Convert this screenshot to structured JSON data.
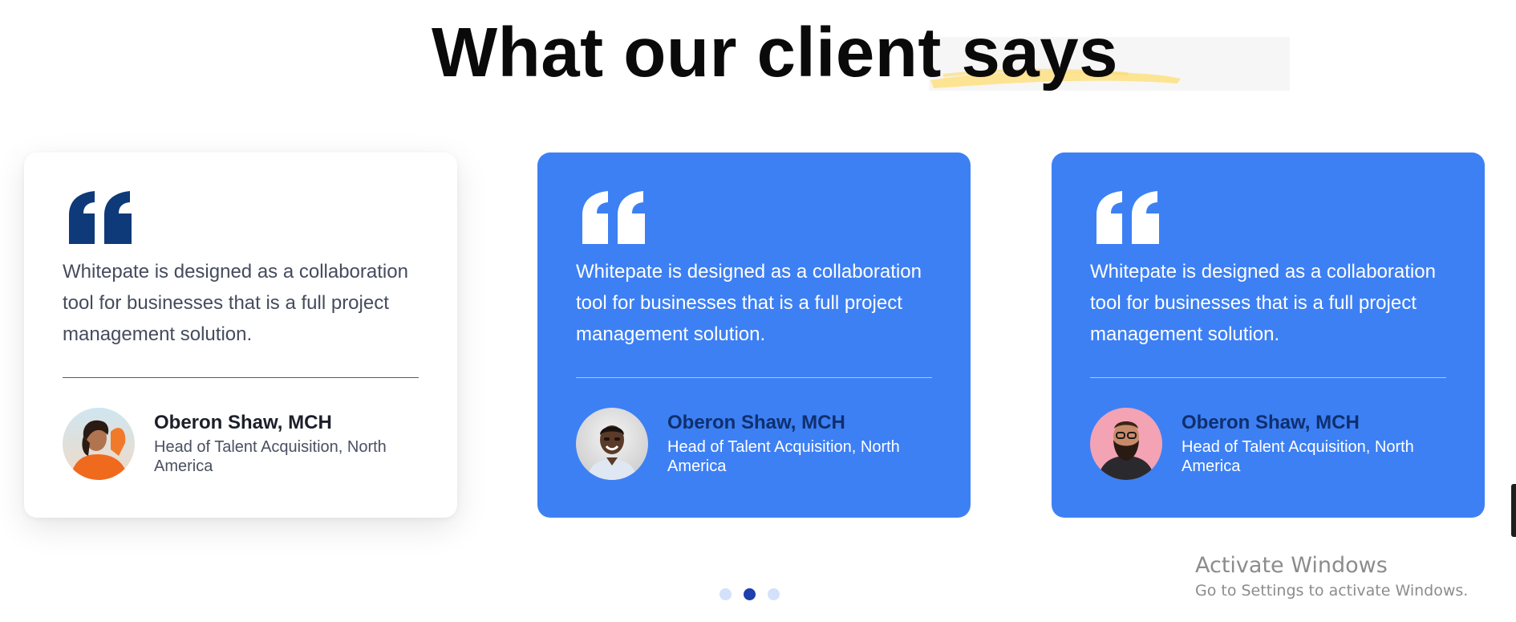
{
  "heading": {
    "main": "What our client ",
    "highlight": "says"
  },
  "colors": {
    "card_blue": "#3d80f4",
    "quote_dark": "#0e3a7a",
    "dot_active": "#1f3fae",
    "dot_inactive": "#d3e1fb",
    "brush_yellow": "#fde492"
  },
  "testimonials": [
    {
      "style": "white",
      "icon": "quote-icon",
      "text": "Whitepate is designed as a collaboration tool for businesses that is a full project management solution.",
      "name": "Oberon Shaw, MCH",
      "role": "Head of Talent Acquisition, North America",
      "avatar": "avatar-woman-orange"
    },
    {
      "style": "blue",
      "icon": "quote-icon",
      "text": "Whitepate is designed as a collaboration tool for businesses that is a full project management solution.",
      "name": "Oberon Shaw, MCH",
      "role": "Head of Talent Acquisition, North America",
      "avatar": "avatar-man-smiling"
    },
    {
      "style": "blue",
      "icon": "quote-icon",
      "text": "Whitepate is designed as a collaboration tool for businesses that is a full project management solution.",
      "name": "Oberon Shaw, MCH",
      "role": "Head of Talent Acquisition, North America",
      "avatar": "avatar-man-bearded"
    }
  ],
  "pagination": {
    "count": 3,
    "active_index": 1
  },
  "watermark": {
    "title": "Activate Windows",
    "subtitle": "Go to Settings to activate Windows."
  }
}
